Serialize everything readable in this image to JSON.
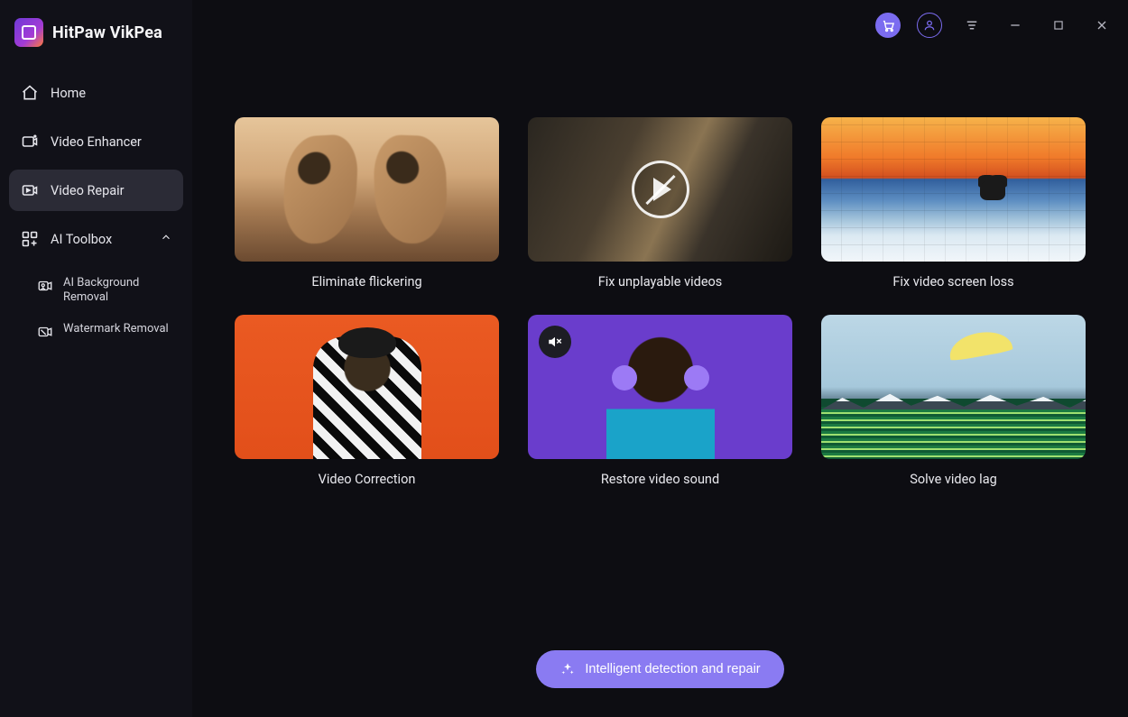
{
  "app": {
    "name": "HitPaw VikPea"
  },
  "titlebar": {
    "store": "store",
    "account": "account",
    "menu": "menu",
    "minimize": "minimize",
    "maximize": "maximize",
    "close": "close"
  },
  "sidebar": {
    "items": [
      {
        "label": "Home",
        "icon": "home-icon"
      },
      {
        "label": "Video Enhancer",
        "icon": "enhancer-icon"
      },
      {
        "label": "Video Repair",
        "icon": "repair-icon",
        "active": true
      },
      {
        "label": "AI Toolbox",
        "icon": "toolbox-icon",
        "expanded": true
      }
    ],
    "toolbox_children": [
      {
        "label": "AI Background Removal",
        "icon": "bg-removal-icon"
      },
      {
        "label": "Watermark Removal",
        "icon": "watermark-removal-icon"
      }
    ]
  },
  "cards": [
    {
      "label": "Eliminate flickering"
    },
    {
      "label": "Fix unplayable videos"
    },
    {
      "label": "Fix video screen loss"
    },
    {
      "label": "Video Correction"
    },
    {
      "label": "Restore video sound"
    },
    {
      "label": "Solve video lag"
    }
  ],
  "action": {
    "label": "Intelligent detection and repair"
  }
}
